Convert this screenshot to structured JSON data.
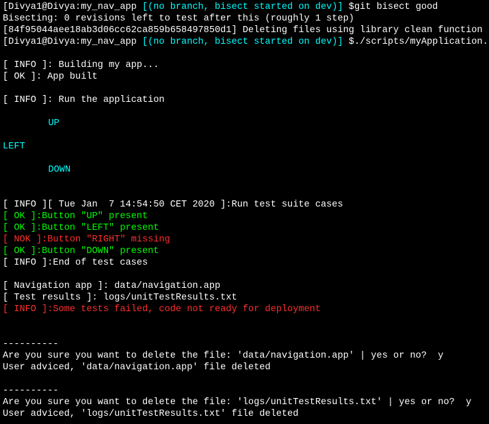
{
  "prompt1": {
    "user_host": "[Divya1@Divya:",
    "cwd": "my_nav_app ",
    "branch": "[(no branch, bisect started on dev)]",
    "dollar": " $",
    "cmd": "git bisect good"
  },
  "bisect_msg": "Bisecting: 0 revisions left to test after this (roughly 1 step)",
  "commit_line": "[84f95044aee18ab3d06cc62ca859b658497850d1] Deleting files using library clean function",
  "prompt2": {
    "user_host": "[Divya1@Divya:",
    "cwd": "my_nav_app ",
    "branch": "[(no branch, bisect started on dev)]",
    "dollar": " $",
    "cmd": "./scripts/myApplication.sh"
  },
  "info_building": "[ INFO ]: Building my app...",
  "ok_built": "[ OK ]: App built",
  "info_run": "[ INFO ]: Run the application",
  "nav": {
    "up": "UP",
    "left": "LEFT",
    "down": "DOWN"
  },
  "info_tests": "[ INFO ][ Tue Jan  7 14:54:50 CET 2020 ]:Run test suite cases",
  "test_up": {
    "tag": "[ OK ]",
    "msg": ":Button \"UP\" present"
  },
  "test_left": {
    "tag": "[ OK ]",
    "msg": ":Button \"LEFT\" present"
  },
  "test_right": {
    "tag": "[ NOK ]",
    "msg": ":Button \"RIGHT\" missing"
  },
  "test_down": {
    "tag": "[ OK ]",
    "msg": ":Button \"DOWN\" present"
  },
  "info_end": "[ INFO ]:End of test cases",
  "nav_app": "[ Navigation app ]: data/navigation.app",
  "test_results": "[ Test results ]: logs/unitTestResults.txt",
  "info_fail": {
    "tag": "[ INFO ]",
    "msg": ":Some tests failed, code not ready for deployment"
  },
  "dashes": "----------",
  "del1_q": "Are you sure you want to delete the file: 'data/navigation.app' | yes or no?  y",
  "del1_a": "User adviced, 'data/navigation.app' file deleted",
  "del2_q": "Are you sure you want to delete the file: 'logs/unitTestResults.txt' | yes or no?  y",
  "del2_a": "User adviced, 'logs/unitTestResults.txt' file deleted"
}
